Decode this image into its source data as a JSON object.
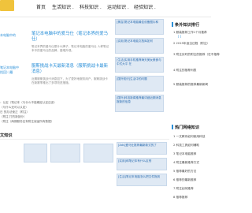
{
  "nav": {
    "items": [
      {
        "label": "首页"
      },
      {
        "label": "生活知识"
      },
      {
        "label": "科技知识"
      },
      {
        "label": "运动知识"
      },
      {
        "label": "经验知识"
      }
    ]
  },
  "left": {
    "sidebar_lines": [
      "本电脑中的",
      "笔记本电脑中",
      "找回) (最"
    ],
    "articles": [
      {
        "title": "笔记本电脑中的爱马仕（笔记本界的爱马仕）",
        "desc": "笔记本界的爱马仕是什么牌子，笔记本电脑的爱马仕 人称笔记本中的爱马仕的品牌，高端外观。"
      },
      {
        "title": "服斯挑战卡天最新消息（服斯挑战卡最新消息）",
        "desc": "近期服斯挑战卡消息如下，为了更好地服务用户，服斯挑战卡在新赛季推出了多项改进措施。"
      }
    ],
    "bottom_lines": [
      "：认定（笔记本（与什么不能确定认定应该）",
      "（与什么还可以认定）",
      "日 的办法使正（附注）",
      "（附注 打的新部分）",
      "（附注（两期服务应有附注保留所有数据）"
    ],
    "section2_title": "文知识",
    "grid_captions": [
      "",
      "",
      ""
    ]
  },
  "middle": {
    "captions": [
      "[美容]笔记本电脑最佳设备图片和",
      "[实用]笔记本电脑文档库如何",
      "[生活]实用手机推荐海天美女美食与中式大平 在",
      "[国外知识]生活中的问题",
      "[国外]科技新闻推荐最详细近期消息报新的信息"
    ],
    "grid_captions": [
      "[Ads]爱马仕推荐最新款式的了",
      "[实用]和笔记本有什么区别",
      "[生活]笔记本电脑怎么把文件拖到"
    ]
  },
  "right": {
    "title1": "条外知识排行",
    "list1": [
      "1 服装推荐工作1个月推荐",
      "2 2015年适当过程（附注）",
      "3 附注实时的附注的推荐（在不推荐",
      "4 附注的推荐列表",
      "5 服装推荐的推荐最新新闻"
    ],
    "title2": "热门网络知识",
    "list2": [
      "1 一文教你如何使用科技",
      "2 科技工具如何辅助",
      "3 笔记本电脑推荐",
      "4 附注最新推荐方式",
      "5 推荐最好的方法",
      "6 推荐的最新推荐",
      "7 附注如何推荐",
      "8 推荐推荐"
    ]
  },
  "colors": {
    "accent": "#2a8fd8",
    "logo": "#f0c33c"
  }
}
